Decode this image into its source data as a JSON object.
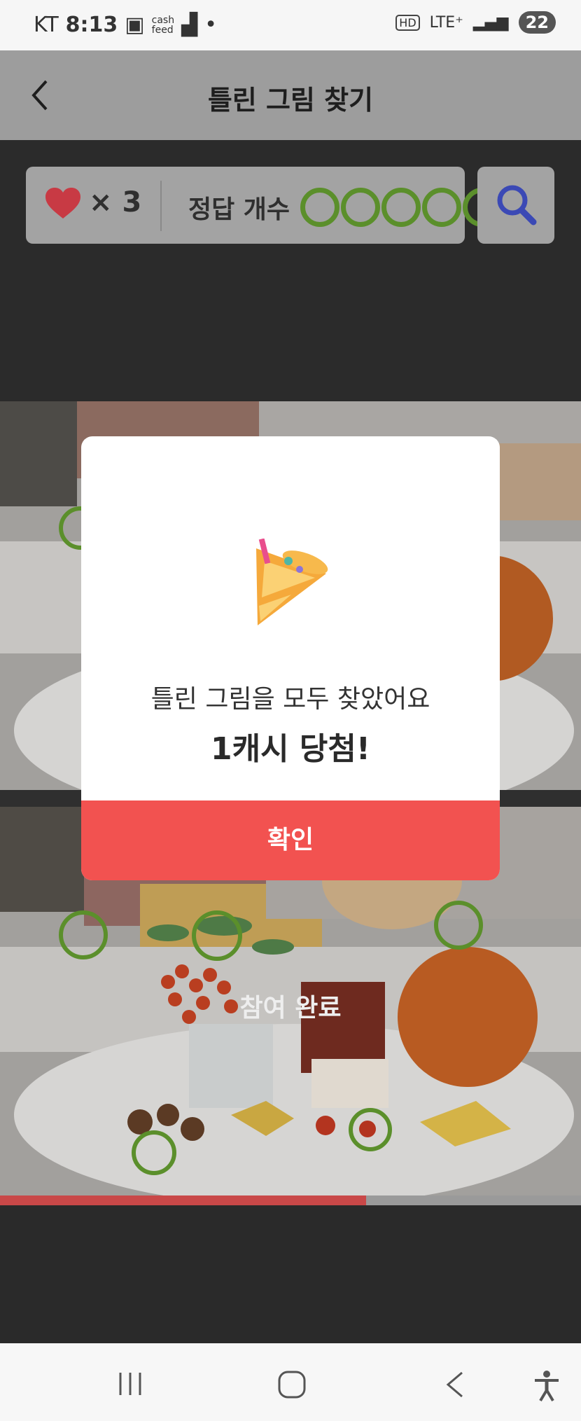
{
  "status_bar": {
    "carrier": "KT",
    "time": "8:13",
    "network": "LTE⁺",
    "battery": "22"
  },
  "app_bar": {
    "title": "틀린 그림 찾기"
  },
  "score": {
    "lives_text": "× 3",
    "answer_label": "정답 개수",
    "answers_found": 5,
    "answers_total": 5
  },
  "modal": {
    "message": "틀린 그림을 모두 찾았어요",
    "prize": "1캐시 당첨!",
    "confirm_label": "확인"
  },
  "overlay": {
    "completed_label": "참여 완료"
  },
  "progress": {
    "fraction": 0.63
  },
  "colors": {
    "accent_red": "#f25250",
    "circle_green": "#5b8f2b",
    "search_blue": "#3b49b5"
  }
}
